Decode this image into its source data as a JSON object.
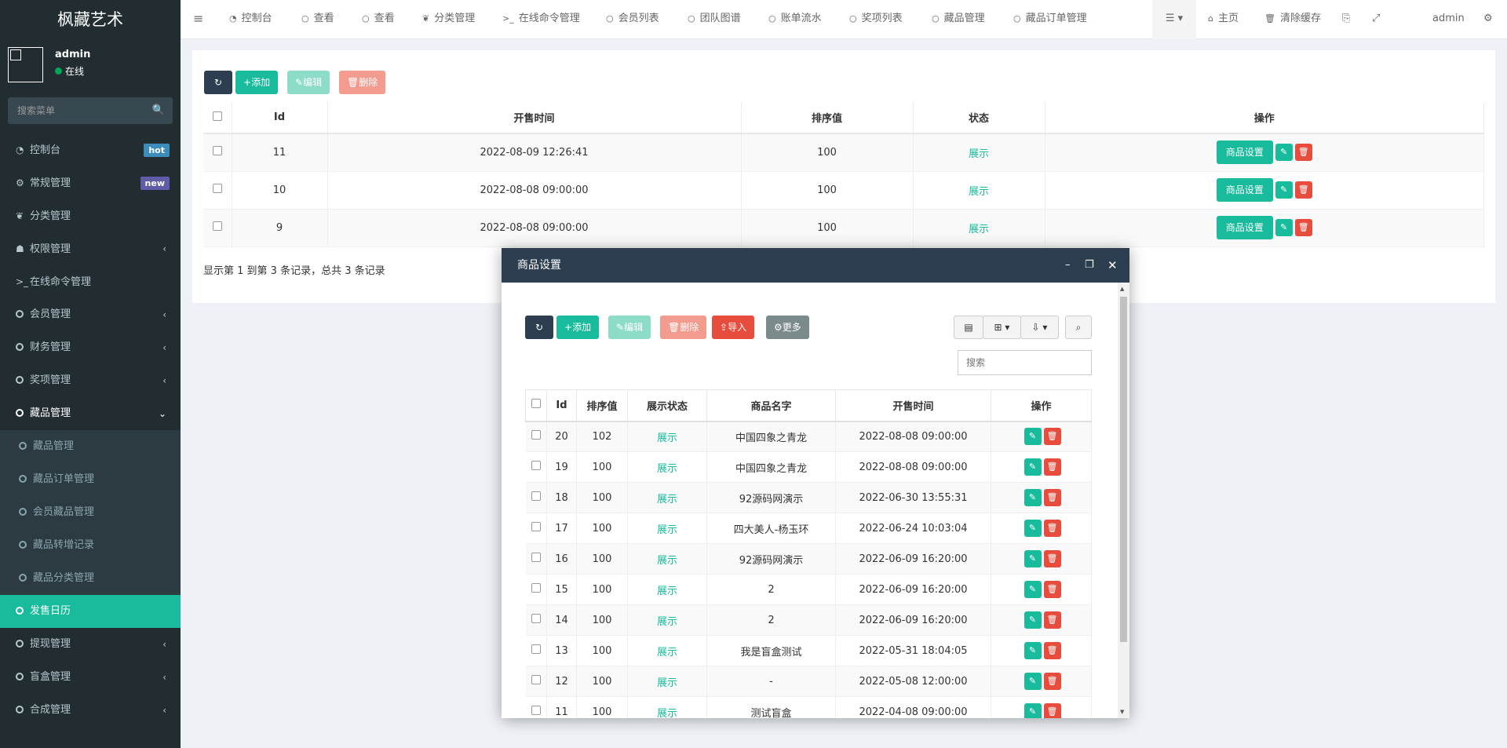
{
  "sidebar": {
    "logo": "枫藏艺术",
    "user": {
      "name": "admin",
      "status": "在线"
    },
    "search_placeholder": "搜索菜单",
    "menu": [
      {
        "label": "控制台",
        "icon": "dashboard-icon",
        "badge": "hot"
      },
      {
        "label": "常规管理",
        "icon": "cogs-icon",
        "badge": "new"
      },
      {
        "label": "分类管理",
        "icon": "leaf-icon"
      },
      {
        "label": "权限管理",
        "icon": "group-icon",
        "arrow": "‹"
      },
      {
        "label": "在线命令管理",
        "icon": "terminal-icon"
      },
      {
        "label": "会员管理",
        "icon": "circle-icon",
        "arrow": "‹"
      },
      {
        "label": "财务管理",
        "icon": "circle-icon",
        "arrow": "‹"
      },
      {
        "label": "奖项管理",
        "icon": "circle-icon",
        "arrow": "‹"
      },
      {
        "label": "藏品管理",
        "icon": "circle-icon",
        "arrow": "⌄"
      },
      {
        "label": "藏品管理",
        "icon": "circle-icon",
        "sub": true
      },
      {
        "label": "藏品订单管理",
        "icon": "circle-icon",
        "sub": true
      },
      {
        "label": "会员藏品管理",
        "icon": "circle-icon",
        "sub": true
      },
      {
        "label": "藏品转增记录",
        "icon": "circle-icon",
        "sub": true
      },
      {
        "label": "藏品分类管理",
        "icon": "circle-icon",
        "sub": true
      },
      {
        "label": "发售日历",
        "icon": "circle-icon",
        "active": true
      },
      {
        "label": "提现管理",
        "icon": "circle-icon",
        "arrow": "‹"
      },
      {
        "label": "盲盒管理",
        "icon": "circle-icon",
        "arrow": "‹"
      },
      {
        "label": "合成管理",
        "icon": "circle-icon",
        "arrow": "‹"
      }
    ]
  },
  "topnav": {
    "menu_toggle": "≡",
    "tabs": [
      {
        "label": "控制台",
        "icon": "dashboard-icon"
      },
      {
        "label": "查看",
        "icon": "circle-icon"
      },
      {
        "label": "查看",
        "icon": "circle-icon"
      },
      {
        "label": "分类管理",
        "icon": "leaf-icon"
      },
      {
        "label": "在线命令管理",
        "icon": "terminal-icon"
      },
      {
        "label": "会员列表",
        "icon": "circle-icon"
      },
      {
        "label": "团队图谱",
        "icon": "circle-icon"
      },
      {
        "label": "账单流水",
        "icon": "circle-icon"
      },
      {
        "label": "奖项列表",
        "icon": "circle-icon"
      },
      {
        "label": "藏品管理",
        "icon": "circle-icon"
      },
      {
        "label": "藏品订单管理",
        "icon": "circle-icon"
      }
    ],
    "home": "主页",
    "clear_cache": "清除缓存",
    "user": "admin"
  },
  "main": {
    "toolbar": {
      "add": "添加",
      "edit": "编辑",
      "delete": "删除"
    },
    "columns": [
      "Id",
      "开售时间",
      "排序值",
      "状态",
      "操作"
    ],
    "rows": [
      {
        "id": "11",
        "time": "2022-08-09 12:26:41",
        "sort": "100",
        "status": "展示",
        "action": "商品设置"
      },
      {
        "id": "10",
        "time": "2022-08-08 09:00:00",
        "sort": "100",
        "status": "展示",
        "action": "商品设置"
      },
      {
        "id": "9",
        "time": "2022-08-08 09:00:00",
        "sort": "100",
        "status": "展示",
        "action": "商品设置"
      }
    ],
    "pager": "显示第 1 到第 3 条记录，总共 3 条记录"
  },
  "modal": {
    "title": "商品设置",
    "toolbar": {
      "add": "添加",
      "edit": "编辑",
      "delete": "删除",
      "import": "导入",
      "more": "更多"
    },
    "search_placeholder": "搜索",
    "columns": [
      "Id",
      "排序值",
      "展示状态",
      "商品名字",
      "开售时间",
      "操作"
    ],
    "rows": [
      {
        "id": "20",
        "sort": "102",
        "status": "展示",
        "name": "中国四象之青龙",
        "time": "2022-08-08 09:00:00"
      },
      {
        "id": "19",
        "sort": "100",
        "status": "展示",
        "name": "中国四象之青龙",
        "time": "2022-08-08 09:00:00"
      },
      {
        "id": "18",
        "sort": "100",
        "status": "展示",
        "name": "92源码网演示",
        "time": "2022-06-30 13:55:31"
      },
      {
        "id": "17",
        "sort": "100",
        "status": "展示",
        "name": "四大美人-杨玉环",
        "time": "2022-06-24 10:03:04"
      },
      {
        "id": "16",
        "sort": "100",
        "status": "展示",
        "name": "92源码网演示",
        "time": "2022-06-09 16:20:00"
      },
      {
        "id": "15",
        "sort": "100",
        "status": "展示",
        "name": "2",
        "time": "2022-06-09 16:20:00"
      },
      {
        "id": "14",
        "sort": "100",
        "status": "展示",
        "name": "2",
        "time": "2022-06-09 16:20:00"
      },
      {
        "id": "13",
        "sort": "100",
        "status": "展示",
        "name": "我是盲盒测试",
        "time": "2022-05-31 18:04:05"
      },
      {
        "id": "12",
        "sort": "100",
        "status": "展示",
        "name": "-",
        "time": "2022-05-08 12:00:00"
      },
      {
        "id": "11",
        "sort": "100",
        "status": "展示",
        "name": "测试盲盒",
        "time": "2022-04-08 09:00:00"
      }
    ]
  },
  "colors": {
    "sidebar": "#222d32",
    "accent": "#18bc9c",
    "danger": "#e74c3c",
    "header": "#2c3e50"
  }
}
